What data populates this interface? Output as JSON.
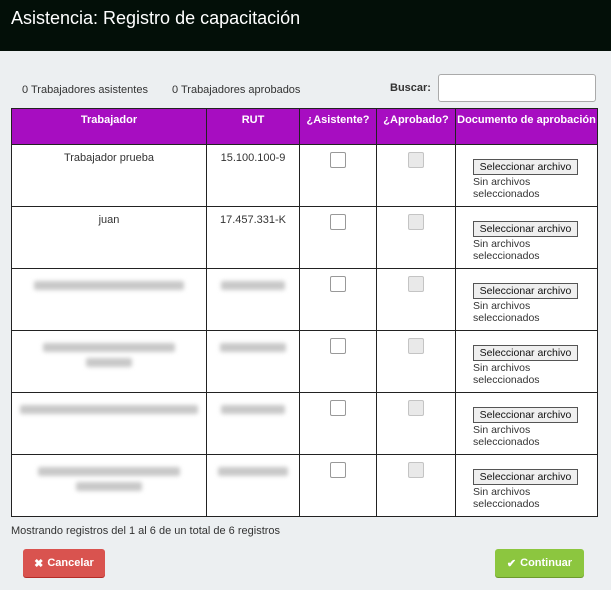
{
  "window": {
    "title": "Asistencia: Registro de capacitación"
  },
  "summary": {
    "attendees": "0 Trabajadores asistentes",
    "approved": "0 Trabajadores aprobados"
  },
  "search": {
    "label": "Buscar:",
    "value": ""
  },
  "table": {
    "headers": {
      "worker": "Trabajador",
      "rut": "RUT",
      "attended": "¿Asistente?",
      "approved": "¿Aprobado?",
      "document": "Documento de aprobación"
    },
    "rows": [
      {
        "worker": "Trabajador prueba",
        "rut": "15.100.100-9",
        "file_button": "Seleccionar archivo",
        "file_status": "Sin archivos seleccionados"
      },
      {
        "worker": "juan",
        "rut": "17.457.331-K",
        "file_button": "Seleccionar archivo",
        "file_status": "Sin archivos seleccionados"
      },
      {
        "worker": "",
        "rut": "",
        "file_button": "Seleccionar archivo",
        "file_status": "Sin archivos seleccionados"
      },
      {
        "worker": "",
        "rut": "",
        "file_button": "Seleccionar archivo",
        "file_status": "Sin archivos seleccionados"
      },
      {
        "worker": "",
        "rut": "",
        "file_button": "Seleccionar archivo",
        "file_status": "Sin archivos seleccionados"
      },
      {
        "worker": "",
        "rut": "",
        "file_button": "Seleccionar archivo",
        "file_status": "Sin archivos seleccionados"
      }
    ]
  },
  "footer": {
    "info": "Mostrando registros del 1 al 6 de un total de 6 registros",
    "cancel_label": "Cancelar",
    "continue_label": "Continuar"
  },
  "icons": {
    "cancel": "times-icon",
    "continue": "check-icon"
  },
  "colors": {
    "header_bg": "#030f08",
    "table_header": "#a70dc1",
    "cancel": "#d9534f",
    "continue": "#8cc63f"
  }
}
